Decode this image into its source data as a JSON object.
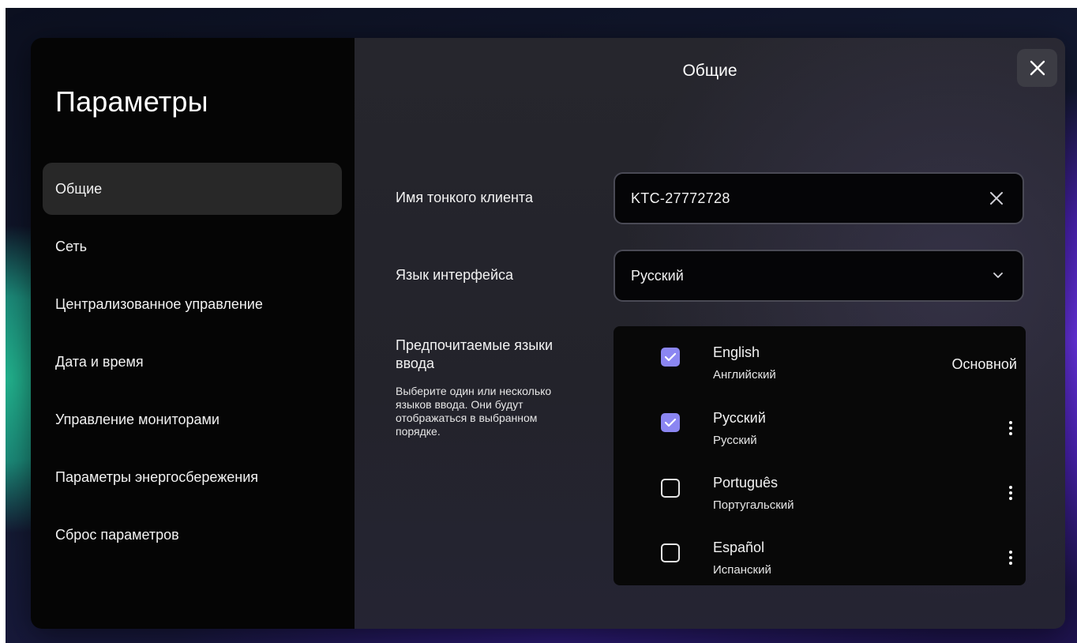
{
  "sidebar": {
    "title": "Параметры",
    "items": [
      {
        "label": "Общие",
        "active": true
      },
      {
        "label": "Сеть"
      },
      {
        "label": "Централизованное управление"
      },
      {
        "label": "Дата и время"
      },
      {
        "label": "Управление мониторами"
      },
      {
        "label": "Параметры энергосбережения"
      },
      {
        "label": "Сброс параметров"
      }
    ]
  },
  "main": {
    "title": "Общие",
    "close_icon": "close-icon",
    "client_name": {
      "label": "Имя тонкого клиента",
      "value": "KTC-27772728",
      "clear_icon": "clear-icon"
    },
    "ui_language": {
      "label": "Язык интерфейса",
      "value": "Русский",
      "chevron_icon": "chevron-down-icon"
    },
    "input_languages": {
      "heading": "Предпочитаемые языки ввода",
      "help": "Выберите один или несколько языков ввода. Они будут отображаться в выбранном порядке.",
      "primary_label": "Основной",
      "items": [
        {
          "name": "English",
          "native": "Английский",
          "checked": true
        },
        {
          "name": "Русский",
          "native": "Русский",
          "checked": true
        },
        {
          "name": "Português",
          "native": "Португальский",
          "checked": false
        },
        {
          "name": "Español",
          "native": "Испанский",
          "checked": false
        }
      ]
    }
  },
  "colors": {
    "accent_checkbox": "#8b86f2",
    "sidebar_bg": "#050505",
    "active_item_bg": "#282828",
    "panel_bg": "#26262d"
  }
}
